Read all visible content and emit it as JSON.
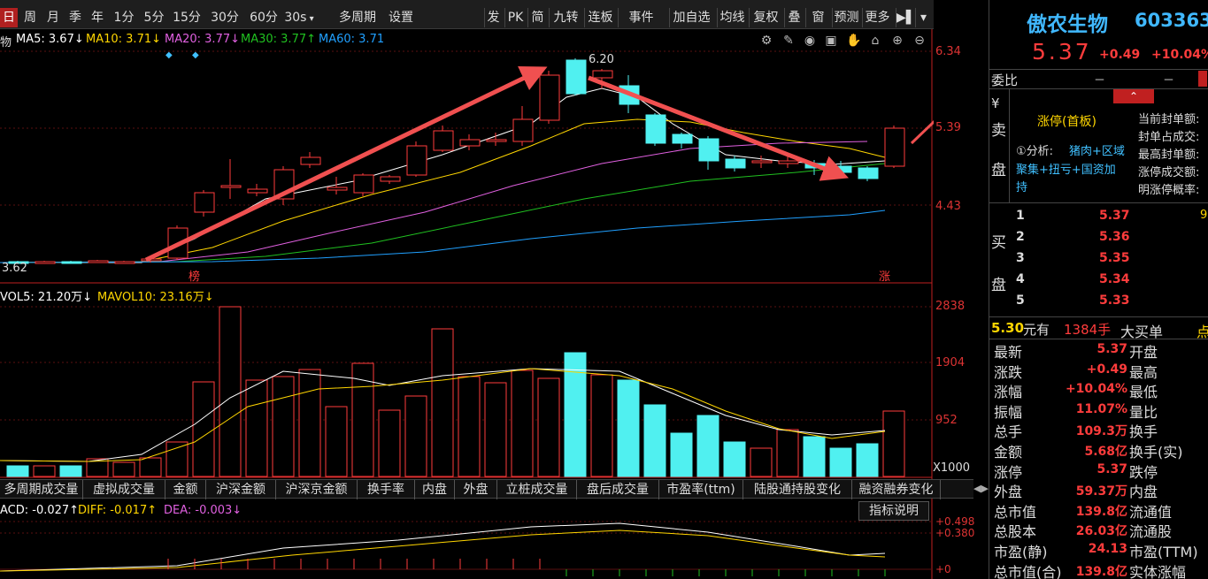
{
  "toolbar": {
    "periods": [
      "日",
      "周",
      "月",
      "季",
      "年",
      "1分",
      "5分",
      "15分",
      "30分",
      "60分",
      "30s",
      "多周期",
      "设置"
    ],
    "right_buttons": [
      "发",
      "PK",
      "简",
      "九转",
      "连板",
      "事件",
      "加自选",
      "均线",
      "复权",
      "叠",
      "窗",
      "预测",
      "更多",
      "▶▌",
      "▾"
    ]
  },
  "ma_line": {
    "stock_abbr": "物",
    "ma5": "MA5: 3.67↓",
    "ma10": "MA10: 3.71↓",
    "ma20": "MA20: 3.77↓",
    "ma30": "MA30: 3.77↑",
    "ma60": "MA60: 3.71"
  },
  "colors": {
    "ma5": "#ffffff",
    "ma10": "#ffd600",
    "ma20": "#e060e0",
    "ma30": "#20c020",
    "ma60": "#20a0ff",
    "up": "#ff3c3c",
    "down": "#50f0f0",
    "arrow": "#f05050"
  },
  "price_axis": {
    "top": "6.34",
    "mid": "5.39",
    "low": "4.43",
    "min_label": "3.62",
    "high_marker": "6.20"
  },
  "markers": {
    "bang": "榜",
    "zhang": "涨"
  },
  "volume": {
    "title_vol5": "VOL5: 21.20万↓",
    "title_mavol10": "MAVOL10: 23.16万↓",
    "axis_top": "2838",
    "axis_mid": "1904",
    "axis_low": "952",
    "unit": "X1000"
  },
  "tabs": [
    "多周期成交量",
    "虚拟成交量",
    "金额",
    "沪深金额",
    "沪深京金额",
    "换手率",
    "内盘",
    "外盘",
    "立桩成交量",
    "盘后成交量",
    "市盈率(ttm)",
    "陆股通持股变化",
    "融资融券变化"
  ],
  "macd": {
    "macd": "ACD: -0.027↑",
    "diff": "DIFF: -0.017↑",
    "dea": "DEA: -0.003↓",
    "help_button": "指标说明",
    "axis_top": "+0.498",
    "axis_mid": "+0.380",
    "axis_zero": "+0"
  },
  "stock": {
    "name": "傲农生物",
    "code": "603363",
    "price": "5.37",
    "change": "+0.49",
    "change_pct": "+10.04%",
    "weibi_label": "委比",
    "weibi_value": "－",
    "weibi_value2": "－"
  },
  "sell_panel": {
    "labels": [
      "¥",
      "卖",
      "",
      "盘"
    ],
    "limit_status": "涨停(首板)",
    "analysis": "①分析: 猪肉+区域聚集+扭亏+国资加持",
    "analysis_head": "①分析:",
    "analysis_tags": "猪肉+区域",
    "analysis_line2": "聚集+扭亏+国资加",
    "analysis_line3": "持",
    "seal_labels": [
      "当前封单额:",
      "封单占成交:",
      "最高封单额:",
      "涨停成交额:",
      "明涨停概率:"
    ]
  },
  "buy_panel": {
    "label": [
      "买",
      "盘"
    ],
    "levels": [
      {
        "n": "1",
        "p": "5.37",
        "v": "9"
      },
      {
        "n": "2",
        "p": "5.36",
        "v": ""
      },
      {
        "n": "3",
        "p": "5.35",
        "v": ""
      },
      {
        "n": "4",
        "p": "5.34",
        "v": ""
      },
      {
        "n": "5",
        "p": "5.33",
        "v": ""
      }
    ]
  },
  "big_order": {
    "price": "5.30",
    "unit": "元有",
    "qty": "1384手",
    "label": "大买单",
    "suffix": "点"
  },
  "stats": [
    {
      "l": "最新",
      "v": "5.37",
      "r": "开盘"
    },
    {
      "l": "涨跌",
      "v": "+0.49",
      "r": "最高"
    },
    {
      "l": "涨幅",
      "v": "+10.04%",
      "r": "最低"
    },
    {
      "l": "振幅",
      "v": "11.07%",
      "r": "量比"
    },
    {
      "l": "总手",
      "v": "109.3万",
      "r": "换手"
    },
    {
      "l": "金额",
      "v": "5.68亿",
      "r": "换手(实)"
    },
    {
      "l": "涨停",
      "v": "5.37",
      "r": "跌停"
    },
    {
      "l": "外盘",
      "v": "59.37万",
      "r": "内盘"
    },
    {
      "l": "总市值",
      "v": "139.8亿",
      "r": "流通值"
    },
    {
      "l": "总股本",
      "v": "26.03亿",
      "r": "流通股"
    },
    {
      "l": "市盈(静)",
      "v": "24.13",
      "r": "市盈(TTM)"
    },
    {
      "l": "总市值(合)",
      "v": "139.8亿",
      "r": "实体涨幅"
    }
  ]
}
